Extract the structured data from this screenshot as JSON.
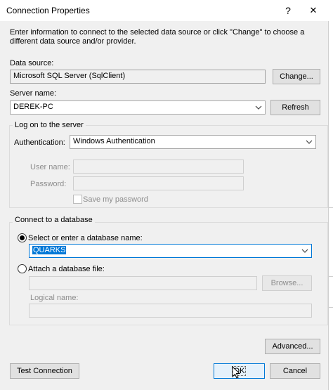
{
  "window": {
    "title": "Connection Properties",
    "help_glyph": "?",
    "close_glyph": "✕"
  },
  "intro_text": "Enter information to connect to the selected data source or click \"Change\" to choose a different data source and/or provider.",
  "data_source": {
    "label": "Data source:",
    "value": "Microsoft SQL Server (SqlClient)",
    "change_label": "Change..."
  },
  "server": {
    "label": "Server name:",
    "value": "DEREK-PC",
    "refresh_label": "Refresh"
  },
  "logon": {
    "group_title": "Log on to the server",
    "auth_label": "Authentication:",
    "auth_value": "Windows Authentication",
    "user_label": "User name:",
    "password_label": "Password:",
    "save_password_label": "Save my password"
  },
  "database": {
    "group_title": "Connect to a database",
    "select_label": "Select or enter a database name:",
    "db_name": "QUARKS",
    "attach_label": "Attach a database file:",
    "browse_label": "Browse...",
    "logical_label": "Logical name:"
  },
  "footer": {
    "advanced_label": "Advanced...",
    "test_label": "Test Connection",
    "ok_label": "OK",
    "cancel_label": "Cancel"
  },
  "colors": {
    "accent": "#0078d7",
    "window_bg": "#f0f0f0"
  }
}
